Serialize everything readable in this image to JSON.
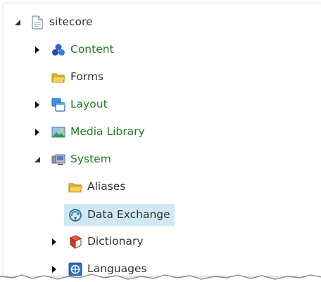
{
  "tree": {
    "root": {
      "label": "sitecore",
      "icon": "page-icon",
      "expanded": true
    },
    "items": [
      {
        "label": "Content",
        "icon": "content-icon",
        "expanded": false,
        "has_children": true,
        "color": "#1f7a1f"
      },
      {
        "label": "Forms",
        "icon": "folder-icon",
        "expanded": false,
        "has_children": false,
        "color": "#333333"
      },
      {
        "label": "Layout",
        "icon": "layout-icon",
        "expanded": false,
        "has_children": true,
        "color": "#1f7a1f"
      },
      {
        "label": "Media Library",
        "icon": "media-library-icon",
        "expanded": false,
        "has_children": true,
        "color": "#1f7a1f"
      },
      {
        "label": "System",
        "icon": "system-icon",
        "expanded": true,
        "has_children": true,
        "color": "#1f7a1f"
      }
    ],
    "system_children": [
      {
        "label": "Aliases",
        "icon": "folder-icon",
        "expanded": false,
        "has_children": false,
        "selected": false
      },
      {
        "label": "Data Exchange",
        "icon": "data-exchange-icon",
        "expanded": false,
        "has_children": false,
        "selected": true
      },
      {
        "label": "Dictionary",
        "icon": "dictionary-icon",
        "expanded": false,
        "has_children": true,
        "selected": false
      },
      {
        "label": "Languages",
        "icon": "languages-icon",
        "expanded": false,
        "has_children": true,
        "selected": false
      }
    ]
  },
  "colors": {
    "selection_background": "#cfe8f4",
    "green_label": "#1f7a1f",
    "default_label": "#333333"
  }
}
